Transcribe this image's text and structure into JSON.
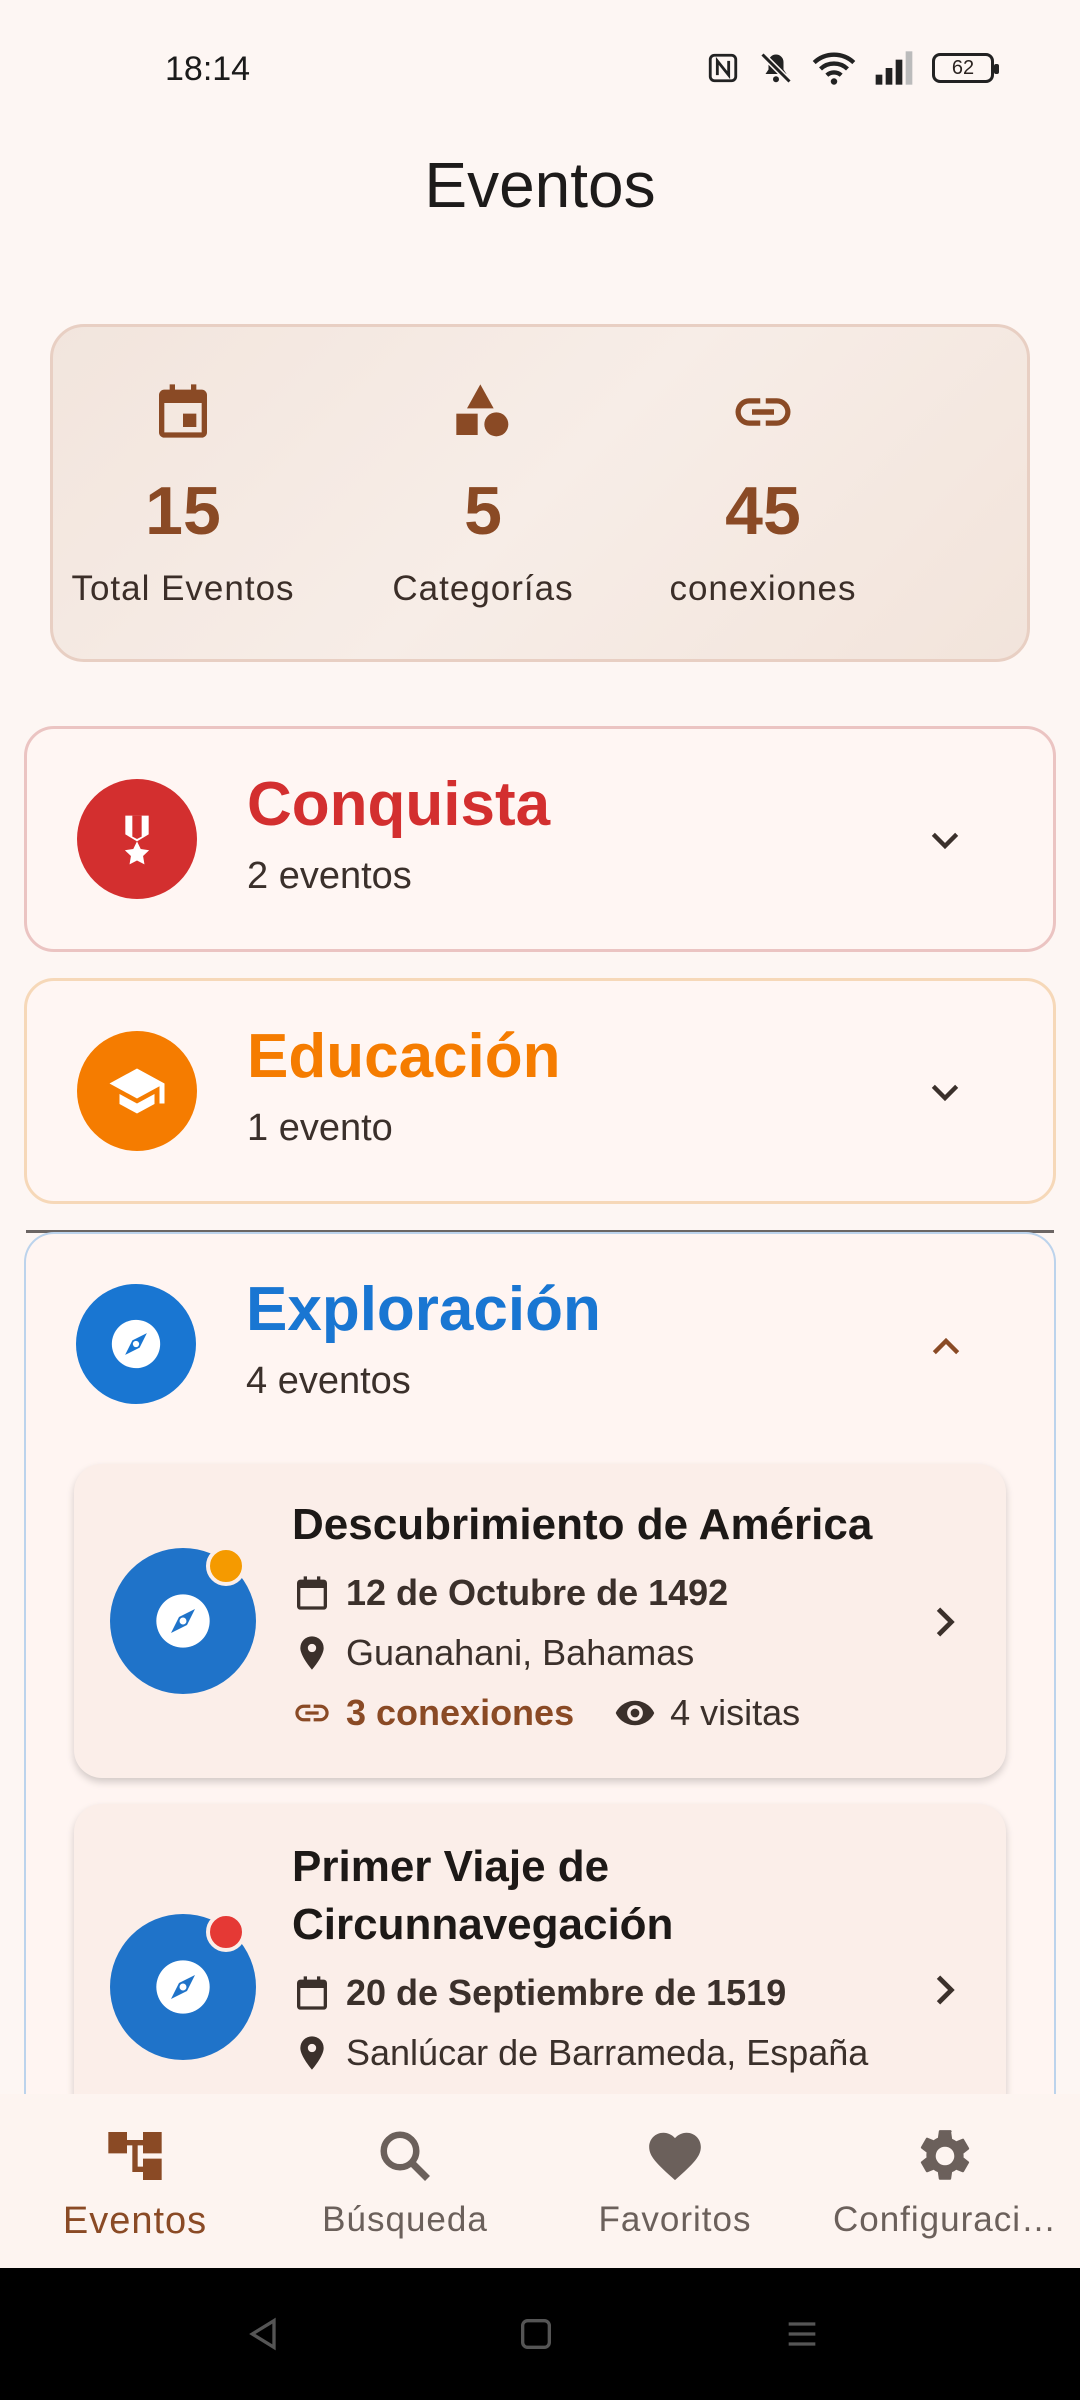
{
  "status": {
    "time": "18:14",
    "battery": "62"
  },
  "app": {
    "title": "Eventos"
  },
  "stats": [
    {
      "icon": "calendar-icon",
      "value": "15",
      "label": "Total Eventos"
    },
    {
      "icon": "shapes-icon",
      "value": "5",
      "label": "Categorías"
    },
    {
      "icon": "link-icon",
      "value": "45",
      "label": "conexiones"
    }
  ],
  "categories": [
    {
      "name": "Conquista",
      "count": "2 eventos",
      "color": "#d32f2f",
      "icon": "medal-icon",
      "expanded": false
    },
    {
      "name": "Educación",
      "count": "1 evento",
      "color": "#f57c00",
      "icon": "school-icon",
      "expanded": false
    },
    {
      "name": "Exploración",
      "count": "4 eventos",
      "color": "#1976d2",
      "icon": "compass-icon",
      "expanded": true
    }
  ],
  "events": [
    {
      "title": "Descubrimiento de América",
      "date": "12 de Octubre de 1492",
      "place": "Guanahani, Bahamas",
      "links": "3 conexiones",
      "views": "4 visitas",
      "dot_color": "#f59a00"
    },
    {
      "title": "Primer Viaje de Circunnavegación",
      "date": "20 de Septiembre de 1519",
      "place": "Sanlúcar de Barrameda, España",
      "dot_color": "#e53935"
    }
  ],
  "nav": [
    {
      "label": "Eventos",
      "icon": "tree-icon",
      "active": true
    },
    {
      "label": "Búsqueda",
      "icon": "search-icon",
      "active": false
    },
    {
      "label": "Favoritos",
      "icon": "heart-icon",
      "active": false
    },
    {
      "label": "Configuraci…",
      "icon": "gear-icon",
      "active": false
    }
  ]
}
